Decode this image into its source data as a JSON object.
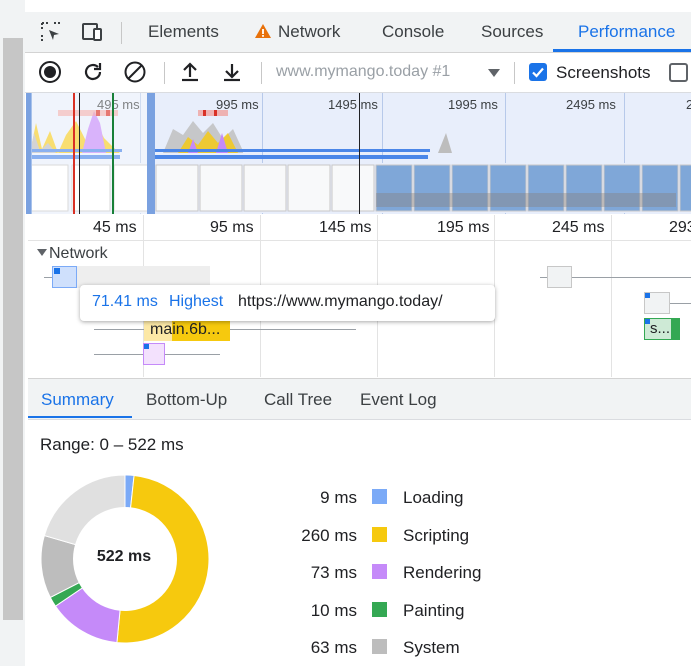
{
  "devtools": {
    "tabs": [
      {
        "label": "Elements",
        "active": false,
        "warning": false
      },
      {
        "label": "Network",
        "active": false,
        "warning": true
      },
      {
        "label": "Console",
        "active": false,
        "warning": false
      },
      {
        "label": "Sources",
        "active": false,
        "warning": false
      },
      {
        "label": "Performance",
        "active": true,
        "warning": false
      }
    ],
    "icons": {
      "inspect": "inspect-element-icon",
      "device": "device-toolbar-icon",
      "warning": "warning-triangle-icon"
    }
  },
  "toolbar": {
    "recording_select": "www.mymango.today #1",
    "screenshots_label": "Screenshots",
    "screenshots_checked": true,
    "memory_checked": false,
    "icons": [
      "record-icon",
      "reload-icon",
      "clear-icon",
      "upload-profile-icon",
      "download-profile-icon",
      "dropdown-arrow-icon"
    ]
  },
  "overview": {
    "ticks": [
      "495 ms",
      "995 ms",
      "1495 ms",
      "1995 ms",
      "2495 ms",
      "2"
    ]
  },
  "timeline": {
    "ticks": [
      "45 ms",
      "95 ms",
      "145 ms",
      "195 ms",
      "245 ms",
      "293"
    ],
    "network_label": "Network",
    "bars": {
      "main_label": "main.6b...",
      "s_label": "s..."
    }
  },
  "tooltip": {
    "time": "71.41 ms",
    "priority": "Highest",
    "url": "https://www.mymango.today/"
  },
  "bottom_tabs": [
    {
      "label": "Summary",
      "active": true
    },
    {
      "label": "Bottom-Up",
      "active": false
    },
    {
      "label": "Call Tree",
      "active": false
    },
    {
      "label": "Event Log",
      "active": false
    }
  ],
  "summary": {
    "range": "Range: 0 – 522 ms",
    "total": "522 ms",
    "categories": [
      {
        "value": "9 ms",
        "label": "Loading",
        "ms": 9,
        "color": "#7baaf7"
      },
      {
        "value": "260 ms",
        "label": "Scripting",
        "ms": 260,
        "color": "#f6c90e"
      },
      {
        "value": "73 ms",
        "label": "Rendering",
        "ms": 73,
        "color": "#c58af9"
      },
      {
        "value": "10 ms",
        "label": "Painting",
        "ms": 10,
        "color": "#34a853"
      },
      {
        "value": "63 ms",
        "label": "System",
        "ms": 63,
        "color": "#bdbdbd"
      }
    ],
    "idle_ms": 107,
    "idle_color": "#e0e0e0"
  }
}
